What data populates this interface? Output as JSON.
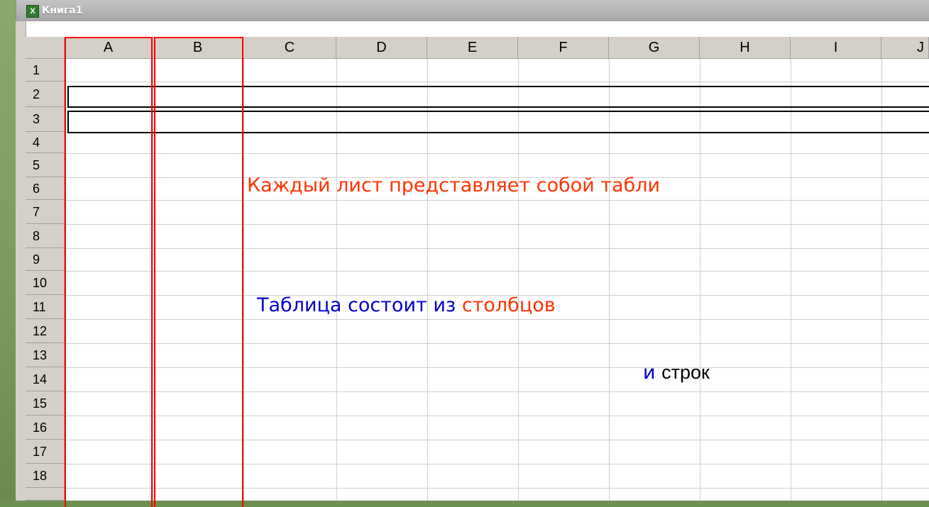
{
  "window": {
    "title": "Книга1"
  },
  "sheet": {
    "columns": [
      "A",
      "B",
      "C",
      "D",
      "E",
      "F",
      "G",
      "H",
      "I",
      "J"
    ],
    "rows": [
      "1",
      "2",
      "3",
      "4",
      "5",
      "6",
      "7",
      "8",
      "9",
      "10",
      "11",
      "12",
      "13",
      "14",
      "15",
      "16",
      "17",
      "18"
    ]
  },
  "annotations": {
    "line1": "Каждый лист представляет собой табли",
    "line2_part1": "Таблица состоит из",
    "line2_part2": "столбцов",
    "line3_part1": "и",
    "line3_part2": "строк"
  },
  "colors": {
    "accent_red": "#ff3300",
    "accent_blue": "#0000cc",
    "highlight_red": "#ff0000",
    "highlight_black": "#000000"
  }
}
